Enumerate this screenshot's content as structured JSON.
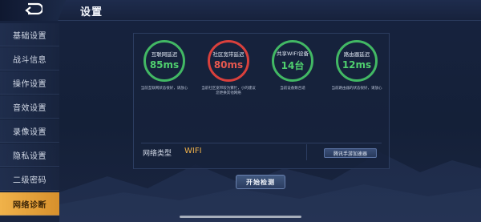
{
  "header": {
    "title": "设置",
    "back_icon": "back-arrow-icon"
  },
  "sidebar": {
    "items": [
      {
        "label": "基础设置",
        "active": false
      },
      {
        "label": "战斗信息",
        "active": false
      },
      {
        "label": "操作设置",
        "active": false
      },
      {
        "label": "音效设置",
        "active": false
      },
      {
        "label": "录像设置",
        "active": false
      },
      {
        "label": "隐私设置",
        "active": false
      },
      {
        "label": "二级密码",
        "active": false
      },
      {
        "label": "网络诊断",
        "active": true
      }
    ]
  },
  "diagnostics": {
    "stats": [
      {
        "label": "互联网延迟",
        "value": "85ms",
        "status_color": "#42b864",
        "desc": "当前互联网状态很好，请放心"
      },
      {
        "label": "社区宽带延迟",
        "value": "80ms",
        "status_color": "#d9403c",
        "desc": "当前社区宽带较为繁忙，小的建议您更换其他网络"
      },
      {
        "label": "共享WIFI设备",
        "value": "14台",
        "status_color": "#42b864",
        "desc": "当前设备数合适"
      },
      {
        "label": "路由器延迟",
        "value": "12ms",
        "status_color": "#42b864",
        "desc": "当前路由器的状态很好，请放心"
      }
    ],
    "network_type_label": "网络类型",
    "network_type_value": "WIFI",
    "accelerator_button": "腾讯手游加速器",
    "start_button": "开始检测"
  }
}
